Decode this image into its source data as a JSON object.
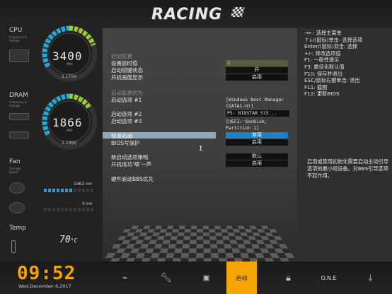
{
  "brand": {
    "logo_text": "RACING"
  },
  "sidebar": {
    "cpu": {
      "label": "CPU",
      "sub": "Frequency & Voltage",
      "freq": "3400",
      "unit": "MHz",
      "voltage": "1.170",
      "voltage_unit": "V"
    },
    "dram": {
      "label": "DRAM",
      "sub": "Frequency & Voltage",
      "freq": "1866",
      "unit": "MHz",
      "voltage": "1.199",
      "voltage_unit": "V"
    },
    "fan": {
      "label": "Fan",
      "sub": "Average Speed",
      "rpm1": "1962",
      "rpm1_unit": "RPM",
      "rpm2": "0",
      "rpm2_unit": "RPM"
    },
    "temp": {
      "label": "Temp",
      "value": "70",
      "unit": "°C"
    }
  },
  "settings": {
    "section1_title": "启动配置",
    "timeout_label": "设置逾时值",
    "timeout_value": "2",
    "numlock_label": "启动锁键状态",
    "numlock_value": "开",
    "splash_label": "开机画面显示",
    "splash_value": "启用",
    "section2_title": "启动装置优先",
    "boot1_label": "启动选项 #1",
    "boot1_value_a": "[Windows Boot Manager",
    "boot1_value_b": "(SATA1-U)]",
    "boot2_label": "启动选项 #2",
    "boot2_value": "P5: BIOSTAR S15...",
    "boot3_label": "启动选项 #3",
    "boot3_value_a": "[UEFI: SanDisk,",
    "boot3_value_b": "Partition 1]",
    "fastboot_label": "快速启动",
    "fastboot_value": "禁用",
    "biosprotect_label": "BIOS写保护",
    "biosprotect_value": "启用",
    "newboot_label": "新启动选项策略",
    "newboot_value": "默认",
    "beep_label": "开机成功‘嘀’一声",
    "beep_value": "启用",
    "hdd_priority_label": "硬件驱动BBS优先"
  },
  "help": {
    "keys": [
      "→←: 选择主菜单",
      "↑↓/(鼠标)单击: 选择选项",
      "Enter/(鼠标)双击: 选择",
      "+/-: 修改选项值",
      "F1: 一般性提示",
      "F3: 最佳化默认值",
      "F10: 保存并退出",
      "ESC/鼠标右键单击: 退出",
      "F11: 截图",
      "F12: 更新BIOS"
    ],
    "description": "启用或禁用初始化需要启动主动引导选项的最小组设备。对BBS引导选项不起作用。"
  },
  "footer": {
    "time": "09:52",
    "date": "Wed,December  6,2017",
    "active_tab": "启动",
    "one_label": "O.N.E"
  },
  "colors": {
    "accent": "#f5a400",
    "selected": "#1e7fc4",
    "gauge_cyan": "#22aadd",
    "gauge_green": "#9acd32"
  }
}
